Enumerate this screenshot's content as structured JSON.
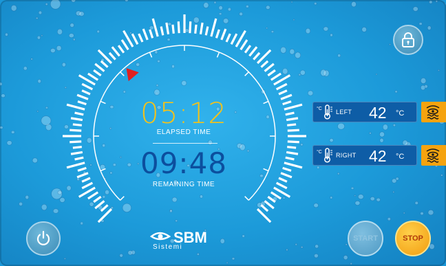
{
  "timer": {
    "elapsed_time": "05:12",
    "elapsed_label": "ELAPSED TIME",
    "remaining_time": "09:48",
    "remaining_label": "REMAINING TIME",
    "elapsed_fraction": 0.35
  },
  "temperatures": {
    "unit_icon": "°C",
    "unit": "°C",
    "left": {
      "label": "LEFT",
      "value": "42"
    },
    "right": {
      "label": "RIGHT",
      "value": "42"
    }
  },
  "buttons": {
    "start": "START",
    "stop": "STOP",
    "lock_icon": "lock-icon",
    "power_icon": "power-icon",
    "view_icon": "eye-heat-icon"
  },
  "brand": {
    "name": "SBM",
    "sub": "Sistemi"
  },
  "colors": {
    "background": "#1c9ad9",
    "elapsed": "#f3c21a",
    "remaining": "#0c4f9e",
    "panel": "#0e5da6",
    "accent": "#f5a30f",
    "pointer": "#e02020"
  }
}
